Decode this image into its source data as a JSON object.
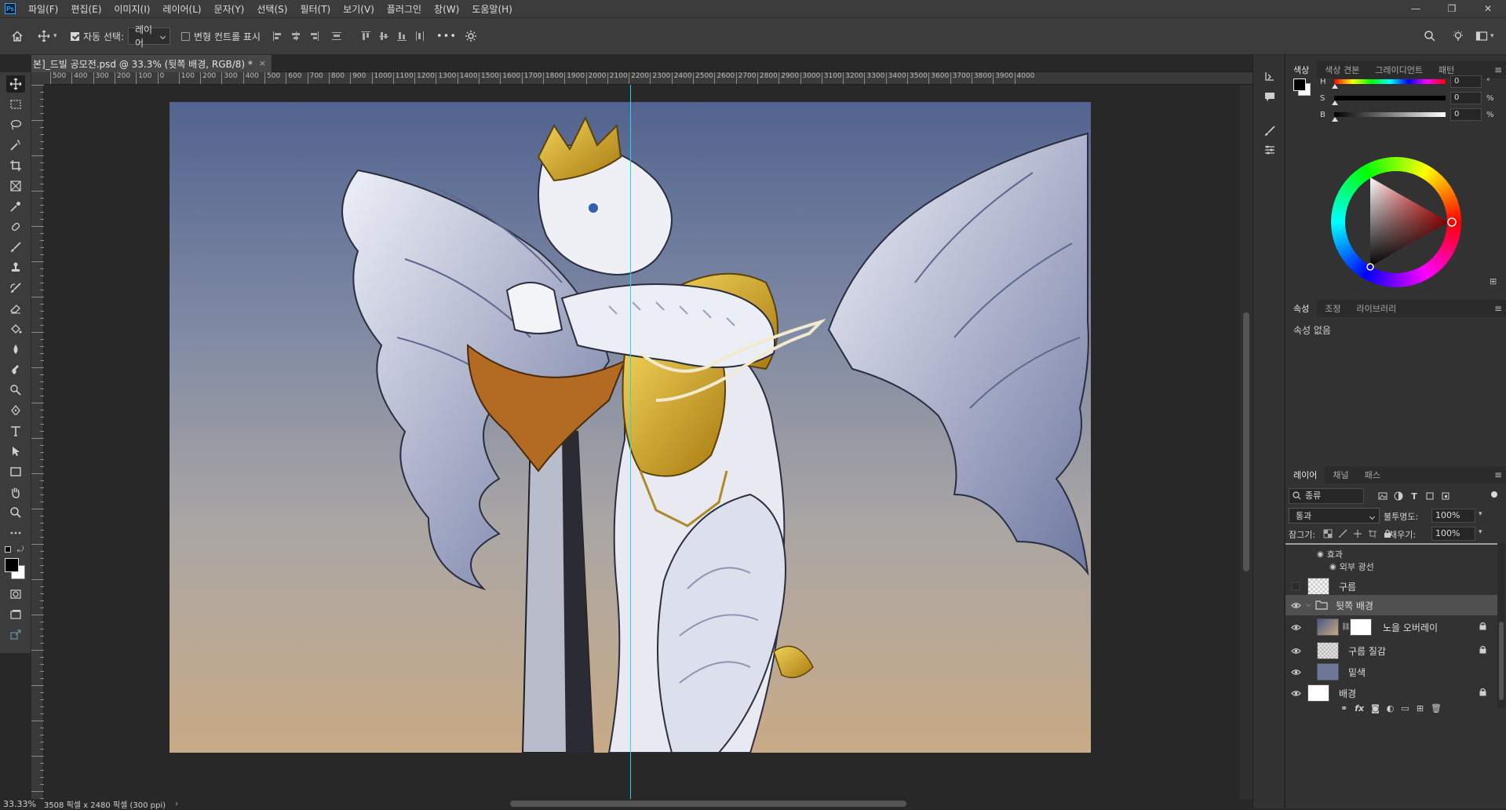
{
  "app": {
    "logo": "Ps"
  },
  "menu": [
    "파일(F)",
    "편집(E)",
    "이미지(I)",
    "레이어(L)",
    "문자(Y)",
    "선택(S)",
    "필터(T)",
    "보기(V)",
    "플러그인",
    "창(W)",
    "도움말(H)"
  ],
  "window_controls": {
    "minimize": "—",
    "restore": "❐",
    "close": "✕"
  },
  "options": {
    "auto_select_label": "자동 선택:",
    "auto_select_checked": true,
    "auto_select_target": "레이어",
    "transform_controls_label": "변형 컨트롤 표시",
    "transform_controls_checked": false,
    "more": "•••"
  },
  "document": {
    "tab_title": "본]_드빌 공모전.psd @ 33.3% (뒷쪽 배경, RGB/8) *",
    "close": "×"
  },
  "ruler_labels": [
    "500",
    "400",
    "300",
    "200",
    "100",
    "0",
    "100",
    "200",
    "300",
    "400",
    "500",
    "600",
    "700",
    "800",
    "900",
    "1000",
    "1100",
    "1200",
    "1300",
    "1400",
    "1500",
    "1600",
    "1700",
    "1800",
    "1900",
    "2000",
    "2100",
    "2200",
    "2300",
    "2400",
    "2500",
    "2600",
    "2700",
    "2800",
    "2900",
    "3000",
    "3100",
    "3200",
    "3300",
    "3400",
    "3500",
    "3600",
    "3700",
    "3800",
    "3900",
    "4000"
  ],
  "status": {
    "zoom": "33.33%",
    "doc_info": "3508 픽셀 x 2480 픽셀 (300 ppi)",
    "arrow": "›"
  },
  "color_panel": {
    "tabs": [
      "색상",
      "색상 견본",
      "그레이디언트",
      "패턴"
    ],
    "active_tab": "색상",
    "sliders": [
      {
        "label": "H",
        "value": "0",
        "unit": "°"
      },
      {
        "label": "S",
        "value": "0",
        "unit": "%"
      },
      {
        "label": "B",
        "value": "0",
        "unit": "%"
      }
    ],
    "foreground": "#000000",
    "background": "#ffffff"
  },
  "properties_panel": {
    "tabs": [
      "속성",
      "조정",
      "라이브러리"
    ],
    "active_tab": "속성",
    "empty_text": "속성 없음"
  },
  "layers_panel": {
    "tabs": [
      "레이어",
      "채널",
      "패스"
    ],
    "active_tab": "레이어",
    "filter_kind": "종류",
    "blend_mode": "통과",
    "opacity_label": "불투명도:",
    "opacity": "100%",
    "lock_label": "잠그기:",
    "fill_label": "채우기:",
    "fill": "100%",
    "effects_label": "효과",
    "outer_glow_label": "외부 광선",
    "layers": [
      {
        "name": "구름",
        "visible": false,
        "type": "cloud",
        "locked": false,
        "indent": false
      },
      {
        "name": "뒷쪽 배경",
        "visible": true,
        "type": "group",
        "locked": false,
        "indent": false,
        "selected": true
      },
      {
        "name": "노을 오버레이",
        "visible": true,
        "type": "gradient-mask",
        "locked": true,
        "indent": true
      },
      {
        "name": "구름 질감",
        "visible": true,
        "type": "texture",
        "locked": true,
        "indent": true
      },
      {
        "name": "밑색",
        "visible": true,
        "type": "solid",
        "locked": false,
        "indent": true
      },
      {
        "name": "배경",
        "visible": true,
        "type": "white",
        "locked": true,
        "indent": false
      }
    ]
  },
  "colors": {
    "accent_guide": "#21d6e8",
    "panel_bg": "#323232",
    "canvas_bg": "#282828"
  }
}
